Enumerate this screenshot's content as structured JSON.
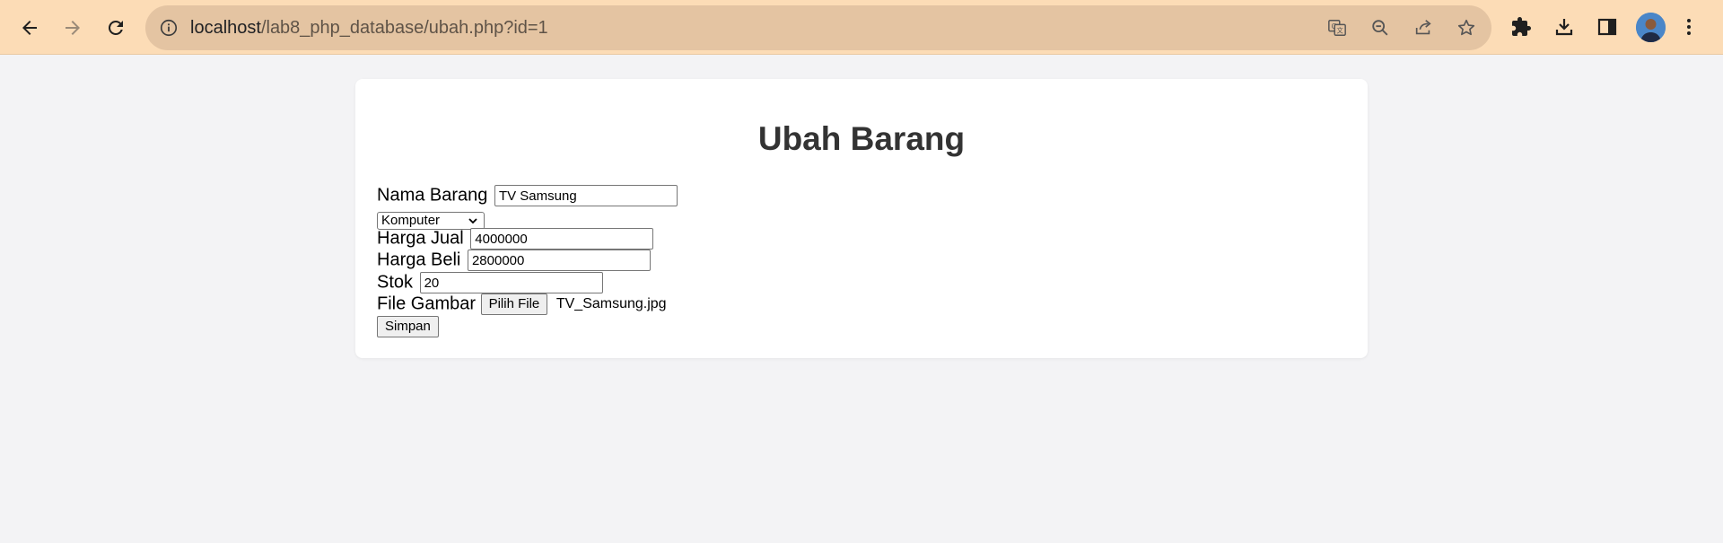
{
  "browser": {
    "url_host": "localhost",
    "url_path": "/lab8_php_database/ubah.php?id=1"
  },
  "page": {
    "title": "Ubah Barang"
  },
  "form": {
    "nama_label": "Nama Barang",
    "nama_value": "TV Samsung",
    "kategori_selected": "Komputer",
    "harga_jual_label": "Harga Jual",
    "harga_jual_value": "4000000",
    "harga_beli_label": "Harga Beli",
    "harga_beli_value": "2800000",
    "stok_label": "Stok",
    "stok_value": "20",
    "file_label": "File Gambar",
    "file_button": "Pilih File",
    "file_name": "TV_Samsung.jpg",
    "submit_label": "Simpan"
  },
  "icons": {
    "back": "back-arrow-icon",
    "forward": "forward-arrow-icon",
    "reload": "reload-icon",
    "site_info": "info-icon",
    "translate": "translate-icon",
    "zoom": "zoom-out-icon",
    "share": "share-icon",
    "bookmark": "star-icon",
    "extensions": "puzzle-icon",
    "downloads": "download-icon",
    "side_panel": "side-panel-icon",
    "profile": "avatar",
    "menu": "kebab-menu-icon"
  },
  "colors": {
    "toolbar": "#fcdcb6",
    "omnibox": "#e4c4a2",
    "page_bg": "#f3f3f5",
    "card_bg": "#ffffff",
    "title": "#333333"
  }
}
